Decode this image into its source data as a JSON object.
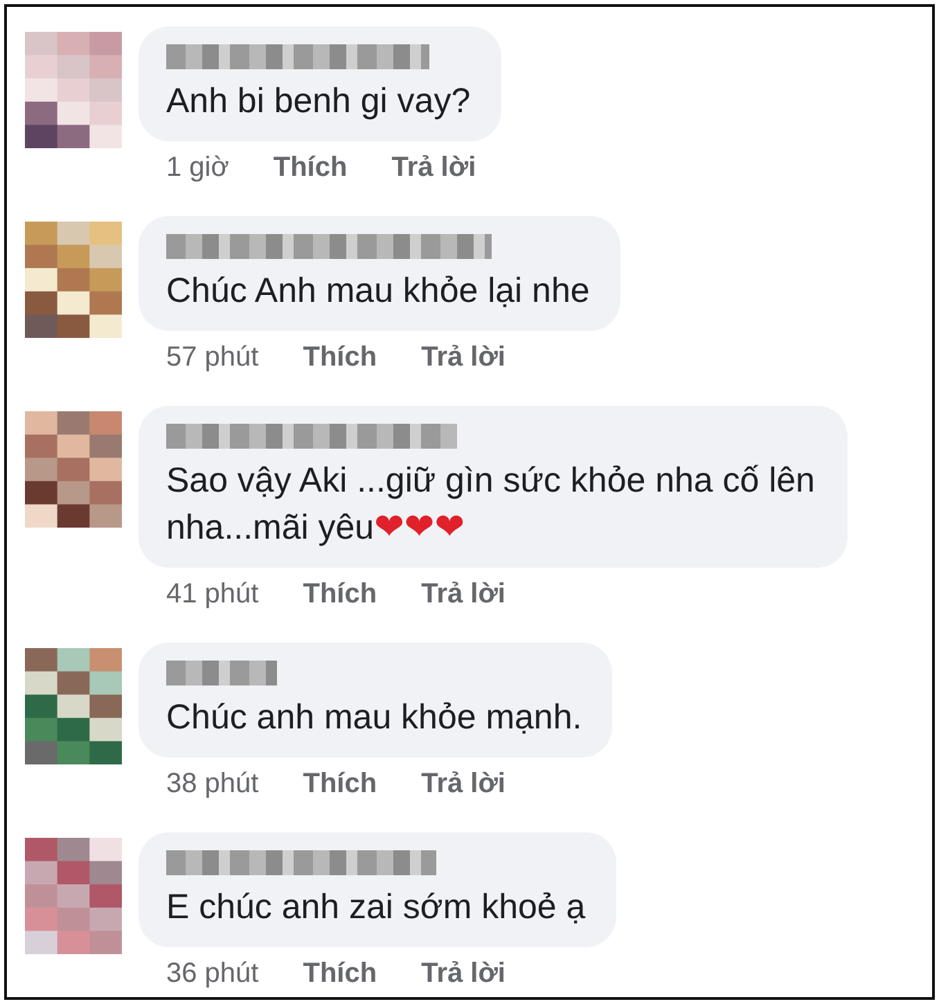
{
  "comments": [
    {
      "text": "Anh bi benh gi vay?",
      "time": "1 giờ",
      "actions": [
        "Thích",
        "Trả lời"
      ]
    },
    {
      "text": "Chúc Anh mau khỏe lại nhe",
      "time": "57 phút",
      "actions": [
        "Thích",
        "Trả lời"
      ]
    },
    {
      "text": "Sao vậy Aki ...giữ gìn sức khỏe nha cố lên nha...mãi yêu",
      "emoji": [
        "❤",
        "❤",
        "❤"
      ],
      "time": "41 phút",
      "actions": [
        "Thích",
        "Trả lời"
      ]
    },
    {
      "text": "Chúc anh mau khỏe mạnh.",
      "time": "38 phút",
      "actions": [
        "Thích",
        "Trả lời"
      ]
    },
    {
      "text": "E chúc anh zai sớm khoẻ ạ",
      "time": "36 phút",
      "actions": [
        "Thích",
        "Trả lời"
      ]
    }
  ]
}
